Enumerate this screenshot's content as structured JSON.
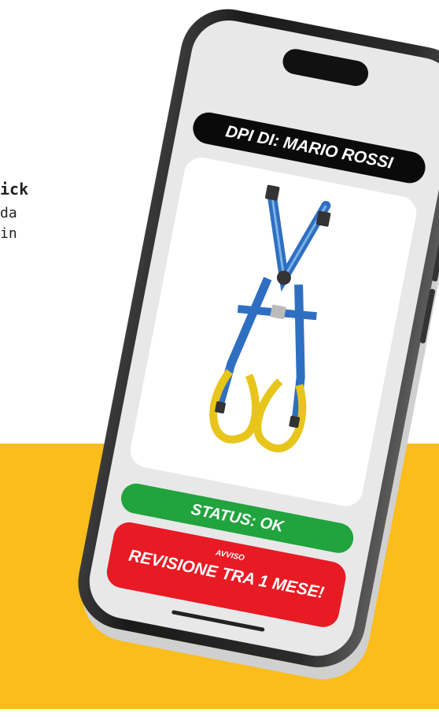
{
  "background": {
    "accent_color": "#fbbd1c",
    "text_lines": [
      "ick",
      "da",
      "in"
    ]
  },
  "phone": {
    "title": "DPI DI: MARIO ROSSI",
    "product_image": "harness-icon",
    "status": {
      "label": "STATUS: OK",
      "color": "#21a33e"
    },
    "warning": {
      "label": "AVVISO",
      "message": "REVISIONE TRA 1 MESE!",
      "color": "#e81a24"
    }
  }
}
